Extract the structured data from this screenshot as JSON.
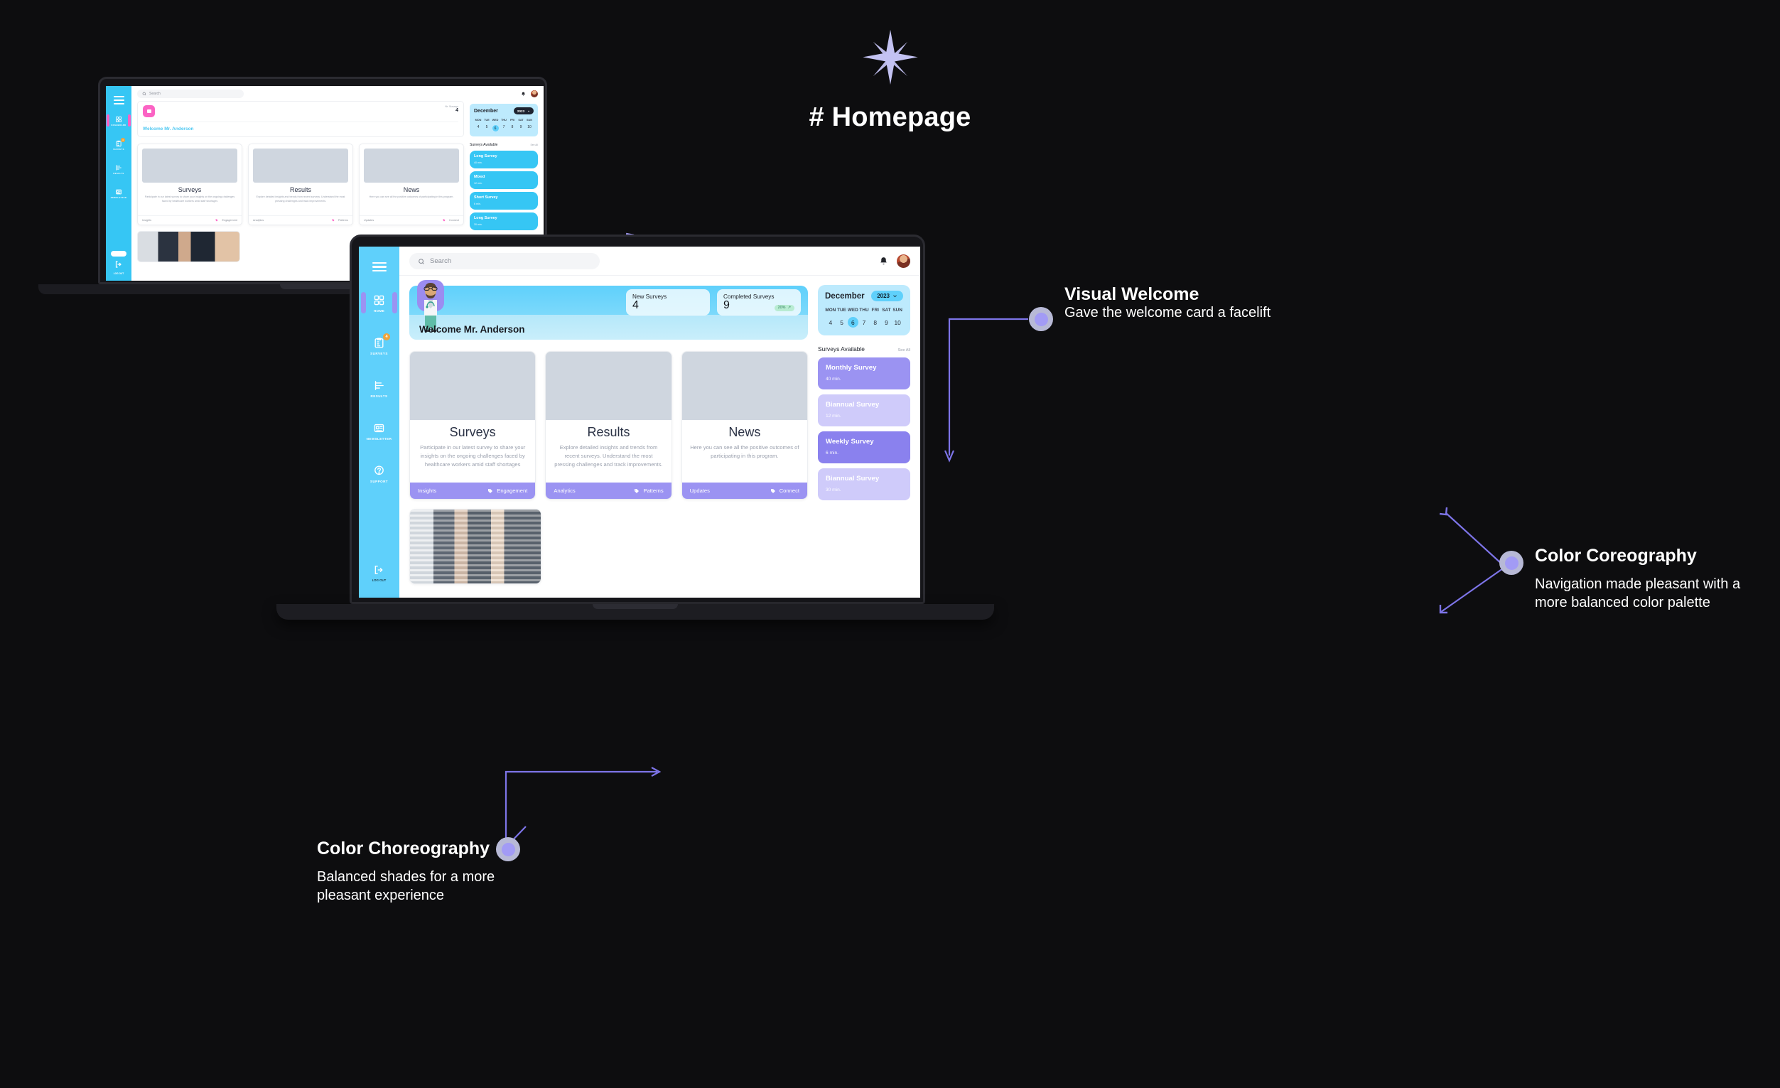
{
  "page": {
    "title": "# Homepage",
    "sparkle_icon": "sparkle-star-icon",
    "accent_purple": "#a29bf5",
    "accent_blue": "#5fd0fb",
    "background": "#0d0d0f"
  },
  "annotations": [
    {
      "id": "visual-welcome",
      "title": "Visual Welcome",
      "body": "Gave the welcome card a facelift"
    },
    {
      "id": "color-coreography",
      "title": "Color Coreography",
      "body": "Navigation made pleasant with a more balanced color palette"
    },
    {
      "id": "color-choreography",
      "title": "Color Choreography",
      "body": "Balanced shades for a more pleasant experience"
    }
  ],
  "app_after": {
    "search": {
      "placeholder": "Search",
      "value": "",
      "icon": "search-icon"
    },
    "header_icons": {
      "bell": "bell-icon",
      "avatar": "user-avatar"
    },
    "sidebar": {
      "menu_icon": "hamburger-menu-icon",
      "items": [
        {
          "label": "HOME",
          "icon": "grid-home-icon",
          "active": true,
          "badge": ""
        },
        {
          "label": "SURVEYS",
          "icon": "clipboard-icon",
          "active": false,
          "badge": "4"
        },
        {
          "label": "RESULTS",
          "icon": "bar-chart-icon",
          "active": false,
          "badge": ""
        },
        {
          "label": "NEWSLETTER",
          "icon": "newsletter-icon",
          "active": false,
          "badge": ""
        },
        {
          "label": "SUPPORT",
          "icon": "question-mark-icon",
          "active": false,
          "badge": ""
        }
      ],
      "logout": {
        "label": "LOG OUT",
        "icon": "logout-icon"
      }
    },
    "welcome": {
      "greeting": "Welcome Mr. Anderson",
      "avatar_icon": "doctor-avatar-icon",
      "stats": [
        {
          "label": "New Surveys",
          "value": "4",
          "delta": ""
        },
        {
          "label": "Completed Surveys",
          "value": "9",
          "delta": "20%",
          "delta_icon": "trend-up-icon"
        }
      ]
    },
    "calendar": {
      "month": "December",
      "year": "2023",
      "chevron_icon": "chevron-down-icon",
      "weekdays": [
        "MON",
        "TUE",
        "WED",
        "THU",
        "FRI",
        "SAT",
        "SUN"
      ],
      "days": [
        "4",
        "5",
        "6",
        "7",
        "8",
        "9",
        "10"
      ],
      "selected_day": "6"
    },
    "surveys_available": {
      "title": "Surveys Available",
      "see_all": "See All",
      "items": [
        {
          "name": "Monthly Survey",
          "time": "40 min.",
          "color": "#9b93f2"
        },
        {
          "name": "Biannual Survey",
          "time": "12 min.",
          "color": "#cfcbfa"
        },
        {
          "name": "Weekly Survey",
          "time": "6 min.",
          "color": "#8a81ee"
        },
        {
          "name": "Biannual Survey",
          "time": "30 min.",
          "color": "#cfcbfa"
        }
      ]
    },
    "cards": [
      {
        "title": "Surveys",
        "desc": "Participate in our latest survey to share your insights on the ongoing challenges faced by healthcare workers amid staff shortages",
        "foot_left": "Insights",
        "foot_right": "Engagement",
        "tag_icon": "tag-icon",
        "image": "woman-pressing-survey-kiosk-photo"
      },
      {
        "title": "Results",
        "desc": "Explore detailed insights and trends from recent surveys. Understand the most pressing challenges and track improvements.",
        "foot_left": "Analytics",
        "foot_right": "Patterns",
        "tag_icon": "tag-icon",
        "image": "laptop-with-charts-photo"
      },
      {
        "title": "News",
        "desc": "Here you can see all the positive outcomes of participating in this program.",
        "foot_left": "Updates",
        "foot_right": "Connect",
        "tag_icon": "tag-icon",
        "image": "two-women-by-video-wall-photo"
      }
    ],
    "bottom_card": {
      "image": "call-center-team-photo"
    },
    "colors": {
      "sidebar": "#5fd0fb",
      "card_footer": "#9b93f2",
      "welcome_gradient_from": "#5fd0fb",
      "welcome_gradient_to": "#bfeafb",
      "calendar_bg": "#bdeafd"
    }
  },
  "app_before": {
    "search": {
      "placeholder": "Search",
      "value": "",
      "icon": "search-icon"
    },
    "sidebar": {
      "menu_icon": "hamburger-menu-icon",
      "items": [
        {
          "label": "DASHBOARD",
          "icon": "grid-home-icon",
          "active": true,
          "badge": ""
        },
        {
          "label": "SURVEYS",
          "icon": "clipboard-icon",
          "active": false,
          "badge": "4"
        },
        {
          "label": "RESULTS",
          "icon": "bar-chart-icon",
          "active": false,
          "badge": ""
        },
        {
          "label": "NEWSLETTER",
          "icon": "newsletter-icon",
          "active": false,
          "badge": ""
        }
      ],
      "logout": {
        "label": "LOG OUT",
        "icon": "logout-icon"
      }
    },
    "welcome": {
      "greeting": "Welcome Mr. Anderson",
      "stat_label": "Nr. Surveys",
      "stat_value": "4",
      "badge_icon": "pink-tile-icon"
    },
    "calendar": {
      "month": "December",
      "year": "2023",
      "weekdays": [
        "MON",
        "TUE",
        "WED",
        "THU",
        "FRI",
        "SAT",
        "SUN"
      ],
      "days": [
        "4",
        "5",
        "6",
        "7",
        "8",
        "9",
        "10"
      ],
      "selected_day": "6"
    },
    "surveys_available": {
      "title": "Surveys Available",
      "see_all": "See All",
      "items": [
        {
          "name": "Long Survey",
          "time": "40 min."
        },
        {
          "name": "Mixed",
          "time": "12 min."
        },
        {
          "name": "Short Survey",
          "time": "6 min."
        },
        {
          "name": "Long Survey",
          "time": "30 min."
        }
      ]
    },
    "cards": [
      {
        "title": "Surveys",
        "desc": "Participate in our latest survey to share your insights on the ongoing challenges faced by healthcare workers amid staff shortages",
        "foot_left": "Insights",
        "foot_right": "Engagement"
      },
      {
        "title": "Results",
        "desc": "Explore detailed insights and trends from recent surveys. Understand the most pressing challenges and track improvements.",
        "foot_left": "Analytics",
        "foot_right": "Patterns"
      },
      {
        "title": "News",
        "desc": "Here you can see all the positive outcomes of participating in this program.",
        "foot_left": "Updates",
        "foot_right": "Connect"
      }
    ],
    "colors": {
      "sidebar": "#36c6f4",
      "accent_pink": "#fb63c4"
    }
  }
}
